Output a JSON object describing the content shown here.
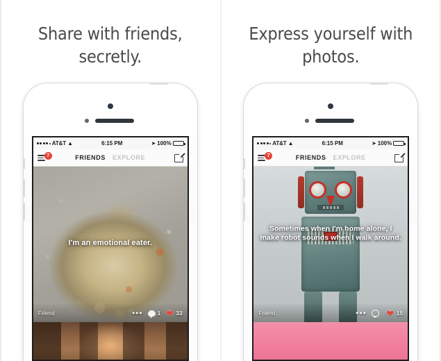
{
  "panels": [
    {
      "headline": "Share with friends, secretly.",
      "phone": {
        "status_bar": {
          "carrier": "AT&T",
          "time": "6:15 PM",
          "battery_percent": "100%",
          "wifi_icon": "wifi-icon",
          "location_icon": "location-arrow-icon",
          "battery_icon": "battery-full-icon",
          "signal_icon": "signal-dots-icon"
        },
        "nav": {
          "menu_icon": "hamburger-menu-icon",
          "menu_badge": "7",
          "tab_active": "FRIENDS",
          "tab_inactive": "EXPLORE",
          "compose_icon": "compose-icon"
        },
        "post": {
          "photo": "marmot-eating-photo",
          "caption": "I'm an emotional eater.",
          "author": "Friend",
          "more_icon": "more-dots-icon",
          "comment_icon": "comment-bubble-icon",
          "comment_count": "1",
          "like_icon": "heart-icon",
          "like_count": "33"
        },
        "next_post_peek": "warm-indoor-photo"
      }
    },
    {
      "headline": "Express yourself with photos.",
      "phone": {
        "status_bar": {
          "carrier": "AT&T",
          "time": "6:15 PM",
          "battery_percent": "100%",
          "wifi_icon": "wifi-icon",
          "location_icon": "location-arrow-icon",
          "battery_icon": "battery-full-icon",
          "signal_icon": "signal-dots-icon"
        },
        "nav": {
          "menu_icon": "hamburger-menu-icon",
          "menu_badge": "7",
          "tab_active": "FRIENDS",
          "tab_inactive": "EXPLORE",
          "compose_icon": "compose-icon"
        },
        "post": {
          "photo": "vintage-tin-robot-photo",
          "caption": "Sometimes when I'm home alone, I make robot sounds when I walk around.",
          "author": "Friend",
          "more_icon": "more-dots-icon",
          "comment_icon": "comment-bubble-icon",
          "comment_count": "",
          "like_icon": "heart-icon",
          "like_count": "15"
        },
        "next_post_peek": "pink-photo"
      }
    }
  ],
  "colors": {
    "badge_red": "#e8443a",
    "heart_red": "#e8443a",
    "headline_gray": "#4a4a4a",
    "tab_inactive_gray": "#c3c3c3",
    "peek_pink": "#f07f9d"
  }
}
